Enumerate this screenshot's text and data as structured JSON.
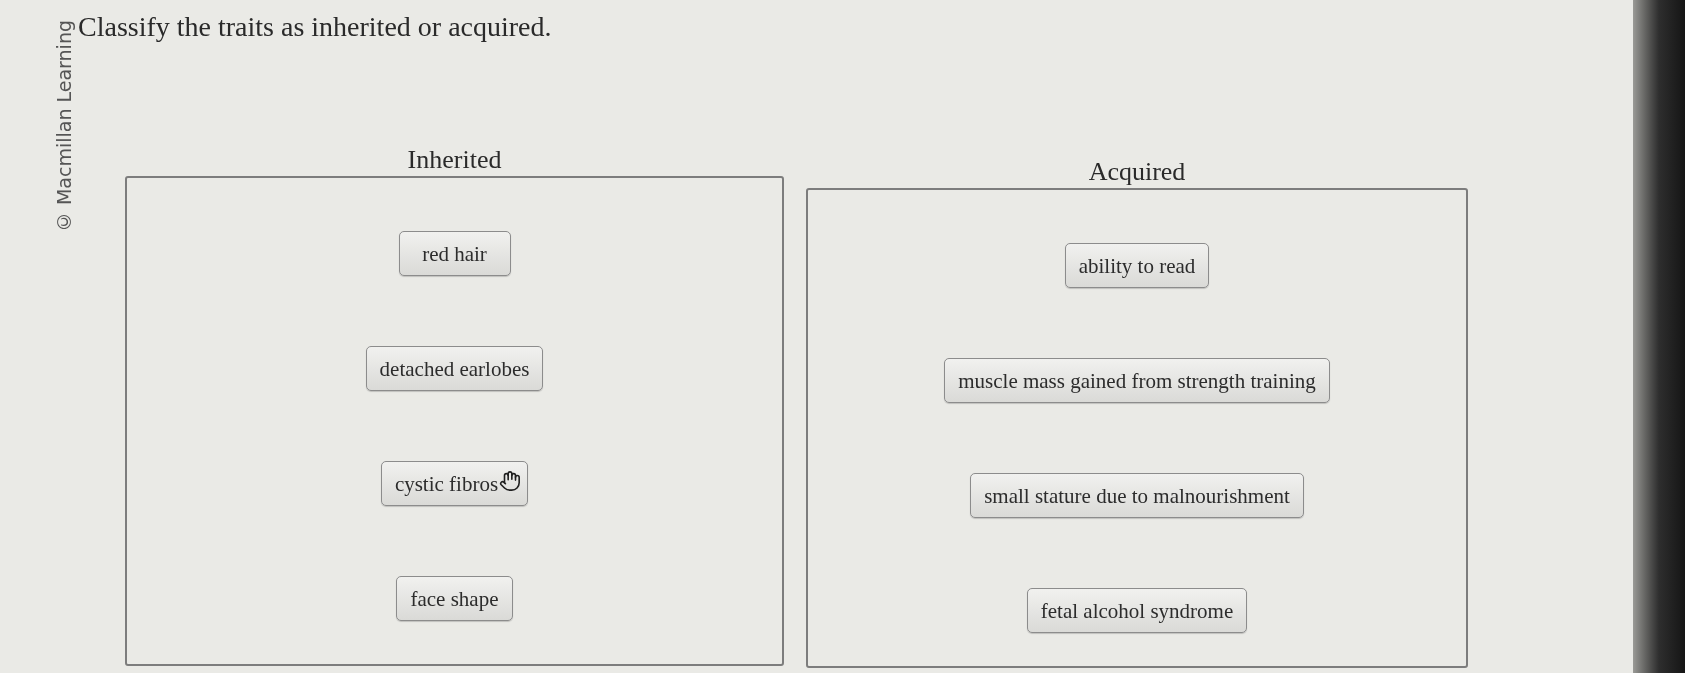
{
  "copyright": "© Macmillan Learning",
  "question": "Classify the traits as inherited or acquired.",
  "bins": [
    {
      "heading": "Inherited",
      "items": [
        {
          "label": "red hair",
          "hovered": false
        },
        {
          "label": "detached earlobes",
          "hovered": false
        },
        {
          "label": "cystic fibros",
          "hovered": true
        },
        {
          "label": "face shape",
          "hovered": false
        }
      ]
    },
    {
      "heading": "Acquired",
      "items": [
        {
          "label": "ability to read",
          "hovered": false
        },
        {
          "label": "muscle mass gained from strength training",
          "hovered": false
        },
        {
          "label": "small stature due to malnourishment",
          "hovered": false
        },
        {
          "label": "fetal alcohol syndrome",
          "hovered": false
        }
      ]
    }
  ]
}
